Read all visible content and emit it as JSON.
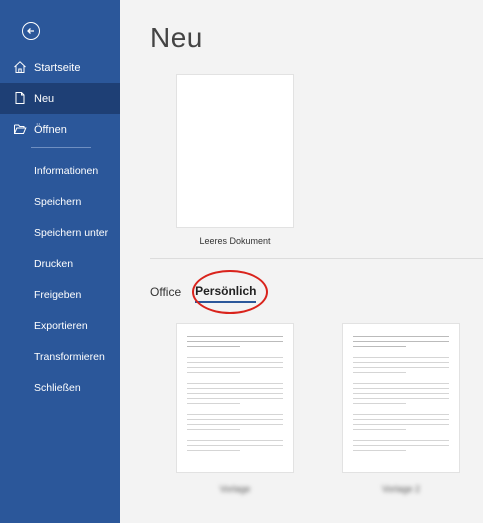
{
  "sidebar": {
    "back_icon": "arrow-left-circle-icon",
    "primary": [
      {
        "label": "Startseite",
        "icon": "home-icon",
        "active": false
      },
      {
        "label": "Neu",
        "icon": "new-document-icon",
        "active": true
      },
      {
        "label": "Öffnen",
        "icon": "folder-open-icon",
        "active": false
      }
    ],
    "secondary": [
      "Informationen",
      "Speichern",
      "Speichern unter",
      "Drucken",
      "Freigeben",
      "Exportieren",
      "Transformieren",
      "Schließen"
    ]
  },
  "main": {
    "title": "Neu",
    "blank_document_label": "Leeres Dokument",
    "tabs": [
      {
        "label": "Office",
        "active": false
      },
      {
        "label": "Persönlich",
        "active": true
      }
    ],
    "templates": [
      {
        "name": "Vorlage"
      },
      {
        "name": "Vorlage 2"
      }
    ]
  },
  "colors": {
    "sidebar": "#2b579a",
    "sidebar_active": "#1e3f75",
    "annotation": "#d9231c"
  }
}
